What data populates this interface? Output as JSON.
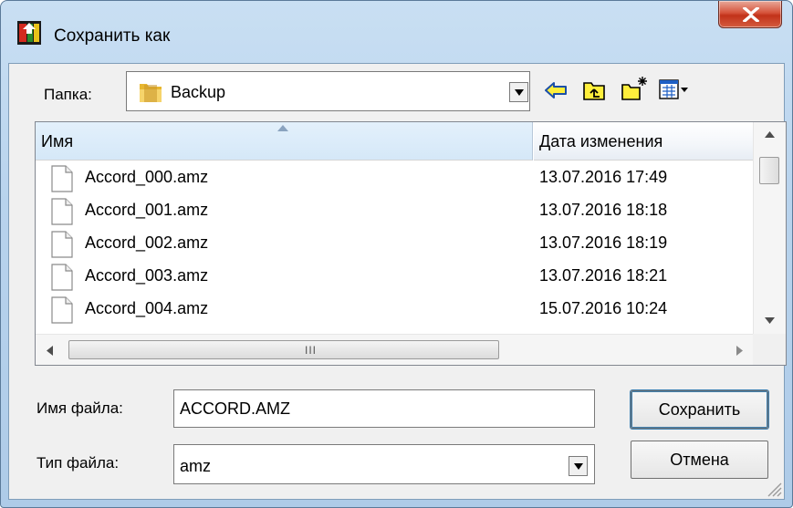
{
  "window": {
    "title": "Сохранить как",
    "close_glyph": "x"
  },
  "folder_bar": {
    "label": "Папка:",
    "current_folder": "Backup",
    "icons": [
      "back-arrow-icon",
      "up-folder-icon",
      "new-folder-icon",
      "view-menu-icon"
    ]
  },
  "file_list": {
    "columns": [
      "Имя",
      "Дата изменения"
    ],
    "rows": [
      {
        "name": "Accord_000.amz",
        "date": "13.07.2016 17:49"
      },
      {
        "name": "Accord_001.amz",
        "date": "13.07.2016 18:18"
      },
      {
        "name": "Accord_002.amz",
        "date": "13.07.2016 18:19"
      },
      {
        "name": "Accord_003.amz",
        "date": "13.07.2016 18:21"
      },
      {
        "name": "Accord_004.amz",
        "date": "15.07.2016 10:24"
      }
    ],
    "hscroll_grip": "III"
  },
  "filename": {
    "label": "Имя файла:",
    "value": "ACCORD.AMZ"
  },
  "filetype": {
    "label": "Тип файла:",
    "value": "amz"
  },
  "buttons": {
    "save": "Сохранить",
    "cancel": "Отмена"
  },
  "colors": {
    "title_bg": "#b8d3ed",
    "close_red": "#c2321a",
    "client_bg": "#f0f0f0"
  }
}
